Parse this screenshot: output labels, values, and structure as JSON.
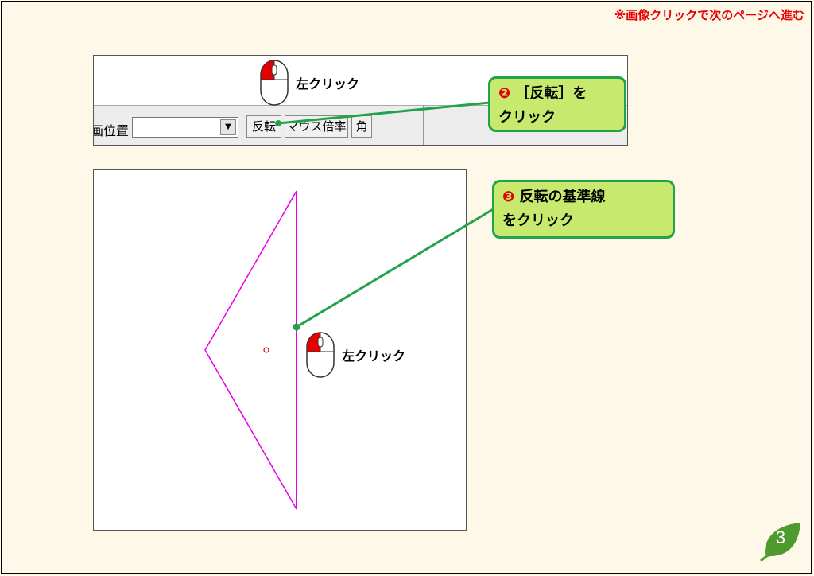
{
  "notice": "※画像クリックで次のページへ進む",
  "toolbar": {
    "position_label": "画位置",
    "position_value": "",
    "buttons": [
      "反転",
      "マウス倍率",
      "角"
    ]
  },
  "mouse_hint_1": "左クリック",
  "mouse_hint_2": "左クリック",
  "callout_step2": {
    "number": "❷",
    "line1": "［反転］を",
    "line2": "クリック"
  },
  "callout_step3": {
    "number": "❸",
    "line1": "反転の基準線",
    "line2": "をクリック"
  },
  "page_number": "3",
  "colors": {
    "callout_fill": "#c6e96e",
    "callout_border": "#22a24b",
    "shape_line": "#e600e6",
    "mouse_button": "#e60000",
    "badge": "#4e9a2e"
  }
}
